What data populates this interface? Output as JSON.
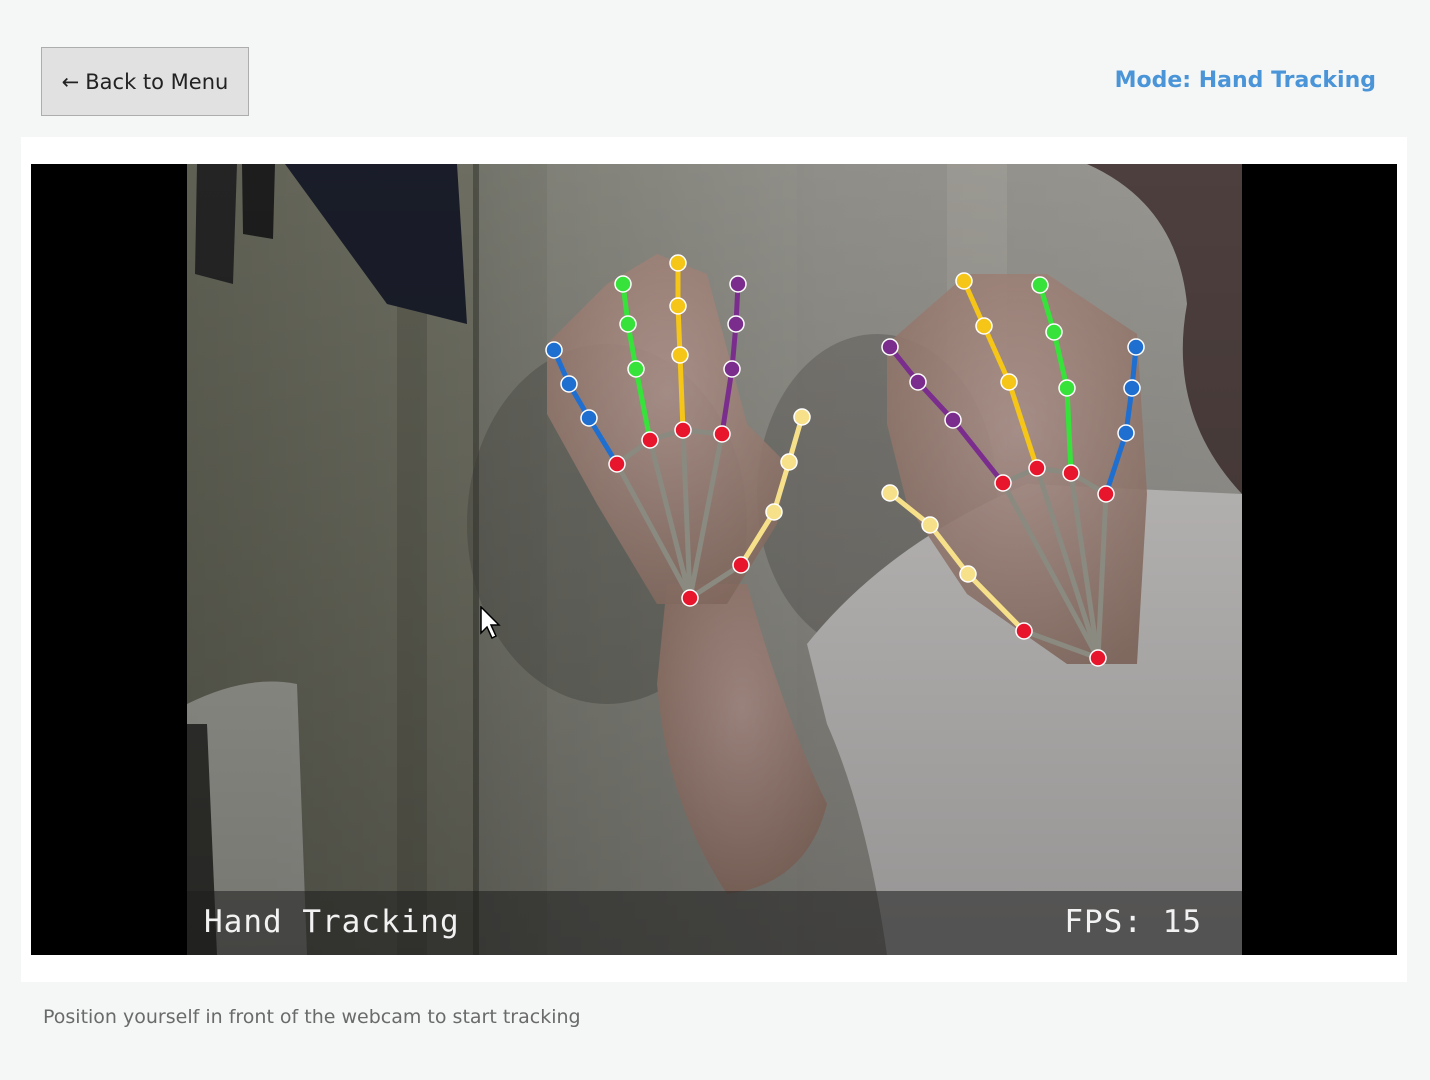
{
  "header": {
    "back_arrow": "←",
    "back_label": "Back to Menu",
    "mode_label": "Mode: Hand Tracking"
  },
  "video": {
    "overlay_title": "Hand Tracking",
    "fps_text": "FPS: 15"
  },
  "footer": {
    "hint": "Position yourself in front of the webcam to start tracking"
  },
  "colors": {
    "accent": "#4a94d8",
    "thumb": "#f7e08a",
    "index": "#1f6fd1",
    "middle": "#f5c518",
    "ring": "#37e23a",
    "pinky": "#7b2d8e",
    "wrist": "#e8162c",
    "palm": "#8a8a80"
  }
}
